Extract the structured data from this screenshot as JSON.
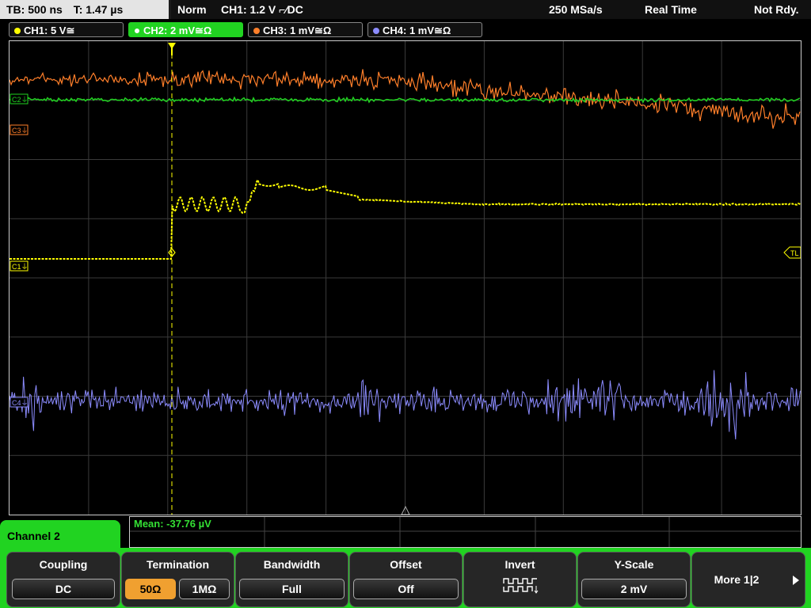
{
  "header": {
    "timebase": "TB: 500 ns",
    "trigger_time": "T: 1.47 µs",
    "trigger_mode": "Norm",
    "trigger_setting": "CH1: 1.2 V ⌐∕DC",
    "sample_rate": "250 MSa/s",
    "acq_mode": "Real Time",
    "status": "Not Rdy."
  },
  "channels": [
    {
      "label": "CH1: 5 V≅",
      "color": "#ffff00"
    },
    {
      "label": "CH2: 2 mV≅Ω",
      "color": "#21d321"
    },
    {
      "label": "CH3: 1 mV≅Ω",
      "color": "#ff7f2a"
    },
    {
      "label": "CH4: 1 mV≅Ω",
      "color": "#8c8cff"
    }
  ],
  "screen": {
    "markers": {
      "c3": "C3⏚",
      "c1": "C1⏚",
      "c2": "C2⏚",
      "c4": "C4⏚",
      "tl": "TL"
    }
  },
  "measurement": {
    "mean": "Mean: -37.76 µV"
  },
  "menu": {
    "title": "Channel 2",
    "coupling": {
      "label": "Coupling",
      "value": "DC"
    },
    "termination": {
      "label": "Termination",
      "opt1": "50Ω",
      "opt2": "1MΩ"
    },
    "bandwidth": {
      "label": "Bandwidth",
      "value": "Full"
    },
    "offset": {
      "label": "Offset",
      "value": "Off"
    },
    "invert": {
      "label": "Invert",
      "icon": "invert-icon"
    },
    "yscale": {
      "label": "Y-Scale",
      "value": "2 mV"
    },
    "more": {
      "label": "More 1|2"
    }
  }
}
